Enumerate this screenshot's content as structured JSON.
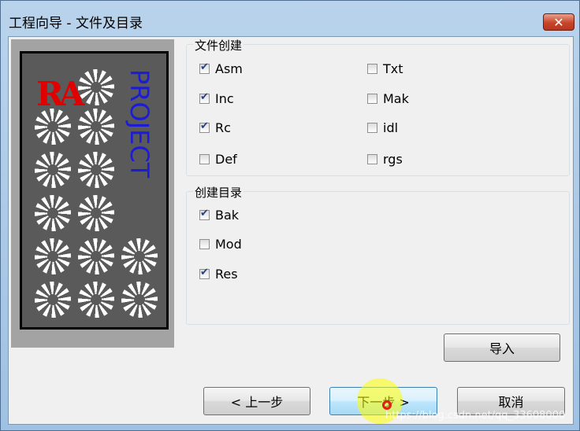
{
  "window": {
    "title": "工程向导 - 文件及目录",
    "close_glyph": "✕"
  },
  "logo": {
    "brand": "RA",
    "project_text": "PROJECT"
  },
  "file_group": {
    "legend": "文件创建",
    "items": [
      {
        "label": "Asm",
        "checked": true
      },
      {
        "label": "Txt",
        "checked": false
      },
      {
        "label": "Inc",
        "checked": true
      },
      {
        "label": "Mak",
        "checked": false
      },
      {
        "label": "Rc",
        "checked": true
      },
      {
        "label": "idl",
        "checked": false
      },
      {
        "label": "Def",
        "checked": false
      },
      {
        "label": "rgs",
        "checked": false
      }
    ]
  },
  "dir_group": {
    "legend": "创建目录",
    "items": [
      {
        "label": "Bak",
        "checked": true
      },
      {
        "label": "Mod",
        "checked": false
      },
      {
        "label": "Res",
        "checked": true
      }
    ]
  },
  "buttons": {
    "import": "导入",
    "back": "< 上一步",
    "next": "下一步 >",
    "cancel": "取消"
  },
  "watermark": "https://blog.csdn.net/qq_33608000"
}
